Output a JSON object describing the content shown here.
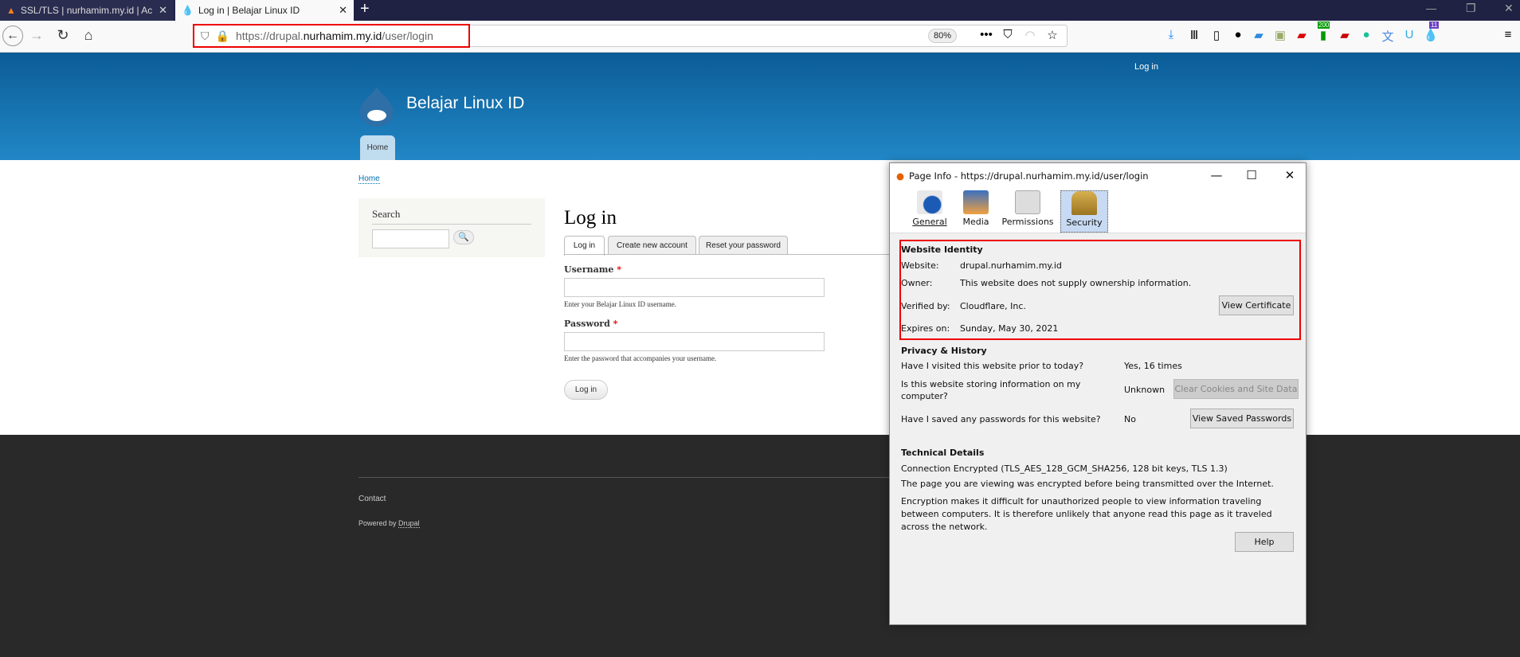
{
  "browser": {
    "tabs": [
      {
        "label": "SSL/TLS | nurhamim.my.id | Ac",
        "active": false
      },
      {
        "label": "Log in | Belajar Linux ID",
        "active": true
      }
    ],
    "new_tab": "+",
    "url_prefix": "https://drupal.",
    "url_domain": "nurhamim.my.id",
    "url_path": "/user/login",
    "zoom": "80%",
    "window_controls": [
      "minimize",
      "restore",
      "close"
    ],
    "extension_badges": {
      "counter": "200",
      "notifications": "11"
    },
    "highlight_color": "#e00000"
  },
  "site": {
    "top_login": "Log in",
    "name": "Belajar Linux ID",
    "nav_home": "Home",
    "breadcrumb": "Home",
    "search_label": "Search",
    "page_title": "Log in",
    "tabs": [
      "Log in",
      "Create new account",
      "Reset your password"
    ],
    "username_label": "Username",
    "username_hint": "Enter your Belajar Linux ID username.",
    "password_label": "Password",
    "password_hint": "Enter the password that accompanies your username.",
    "required_mark": "*",
    "login_button": "Log in",
    "footer_contact": "Contact",
    "footer_powered": "Powered by",
    "footer_drupal": "Drupal"
  },
  "dialog": {
    "title": "Page Info - https://drupal.nurhamim.my.id/user/login",
    "tabs": [
      "General",
      "Media",
      "Permissions",
      "Security"
    ],
    "identity": {
      "heading": "Website Identity",
      "website_label": "Website:",
      "website": "drupal.nurhamim.my.id",
      "owner_label": "Owner:",
      "owner": "This website does not supply ownership information.",
      "verified_label": "Verified by:",
      "verified": "Cloudflare, Inc.",
      "expires_label": "Expires on:",
      "expires": "Sunday, May 30, 2021",
      "view_cert": "View Certificate"
    },
    "privacy": {
      "heading": "Privacy & History",
      "q1": "Have I visited this website prior to today?",
      "a1": "Yes, 16 times",
      "q2": "Is this website storing information on my computer?",
      "a2": "Unknown",
      "clear_btn": "Clear Cookies and Site Data",
      "q3": "Have I saved any passwords for this website?",
      "a3": "No",
      "passwords_btn": "View Saved Passwords"
    },
    "technical": {
      "heading": "Technical Details",
      "connection": "Connection Encrypted (TLS_AES_128_GCM_SHA256, 128 bit keys, TLS 1.3)",
      "p1": "The page you are viewing was encrypted before being transmitted over the Internet.",
      "p2": "Encryption makes it difficult for unauthorized people to view information traveling between computers. It is therefore unlikely that anyone read this page as it traveled across the network."
    },
    "help": "Help"
  }
}
